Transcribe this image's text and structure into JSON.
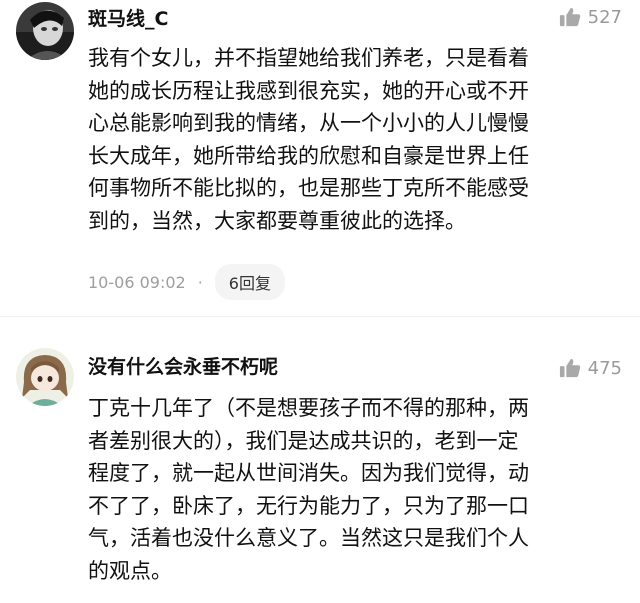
{
  "comments": [
    {
      "username": "斑马线_C",
      "likes": "527",
      "lines": [
        "我有个女儿，并不指望她给我们养老，只是看着",
        "她的成长历程让我感到很充实，她的开心或不开",
        "心总能影响到我的情绪，从一个小小的人儿慢慢",
        "长大成年，她所带给我的欣慰和自豪是世界上任",
        "何事物所不能比拟的，也是那些丁克所不能感受",
        "到的，当然，大家都要尊重彼此的选择。"
      ],
      "time": "10-06 09:02",
      "separator": "·",
      "replies": "6回复"
    },
    {
      "username": "没有什么会永垂不朽呢",
      "likes": "475",
      "lines": [
        "丁克十几年了（不是想要孩子而不得的那种，两",
        "者差别很大的），我们是达成共识的，老到一定",
        "程度了，就一起从世间消失。因为我们觉得，动",
        "不了了，卧床了，无行为能力了，只为了那一口",
        "气，活着也没什么意义了。当然这只是我们个人",
        "的观点。"
      ]
    }
  ],
  "icons": {
    "like": "thumbs-up-icon"
  }
}
